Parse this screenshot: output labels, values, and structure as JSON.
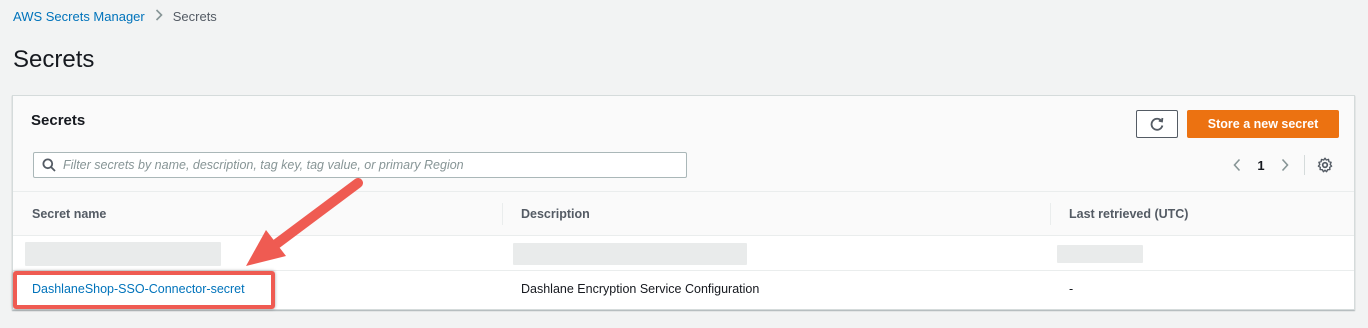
{
  "breadcrumb": {
    "parent": "AWS Secrets Manager",
    "current": "Secrets"
  },
  "page": {
    "title": "Secrets"
  },
  "panel": {
    "title": "Secrets",
    "primary_button": "Store a new secret",
    "search_placeholder": "Filter secrets by name, description, tag key, tag value, or primary Region",
    "pagination": {
      "current_page": "1"
    }
  },
  "table": {
    "columns": [
      "Secret name",
      "Description",
      "Last retrieved (UTC)"
    ],
    "rows": [
      {
        "name": "",
        "description": "",
        "last_retrieved": "",
        "redacted": true
      },
      {
        "name": "DashlaneShop-SSO-Connector-secret",
        "description": "Dashlane Encryption Service Configuration",
        "last_retrieved": "-"
      }
    ]
  },
  "icons": {
    "refresh": "refresh-icon",
    "search": "search-icon",
    "prev": "chevron-left-icon",
    "next": "chevron-right-icon",
    "settings": "gear-icon",
    "breadcrumb_separator": "chevron-right-icon"
  },
  "colors": {
    "accent": "#ec7211",
    "link": "#0073bb",
    "annotation": "#ef5b52",
    "background": "#f2f3f3"
  }
}
